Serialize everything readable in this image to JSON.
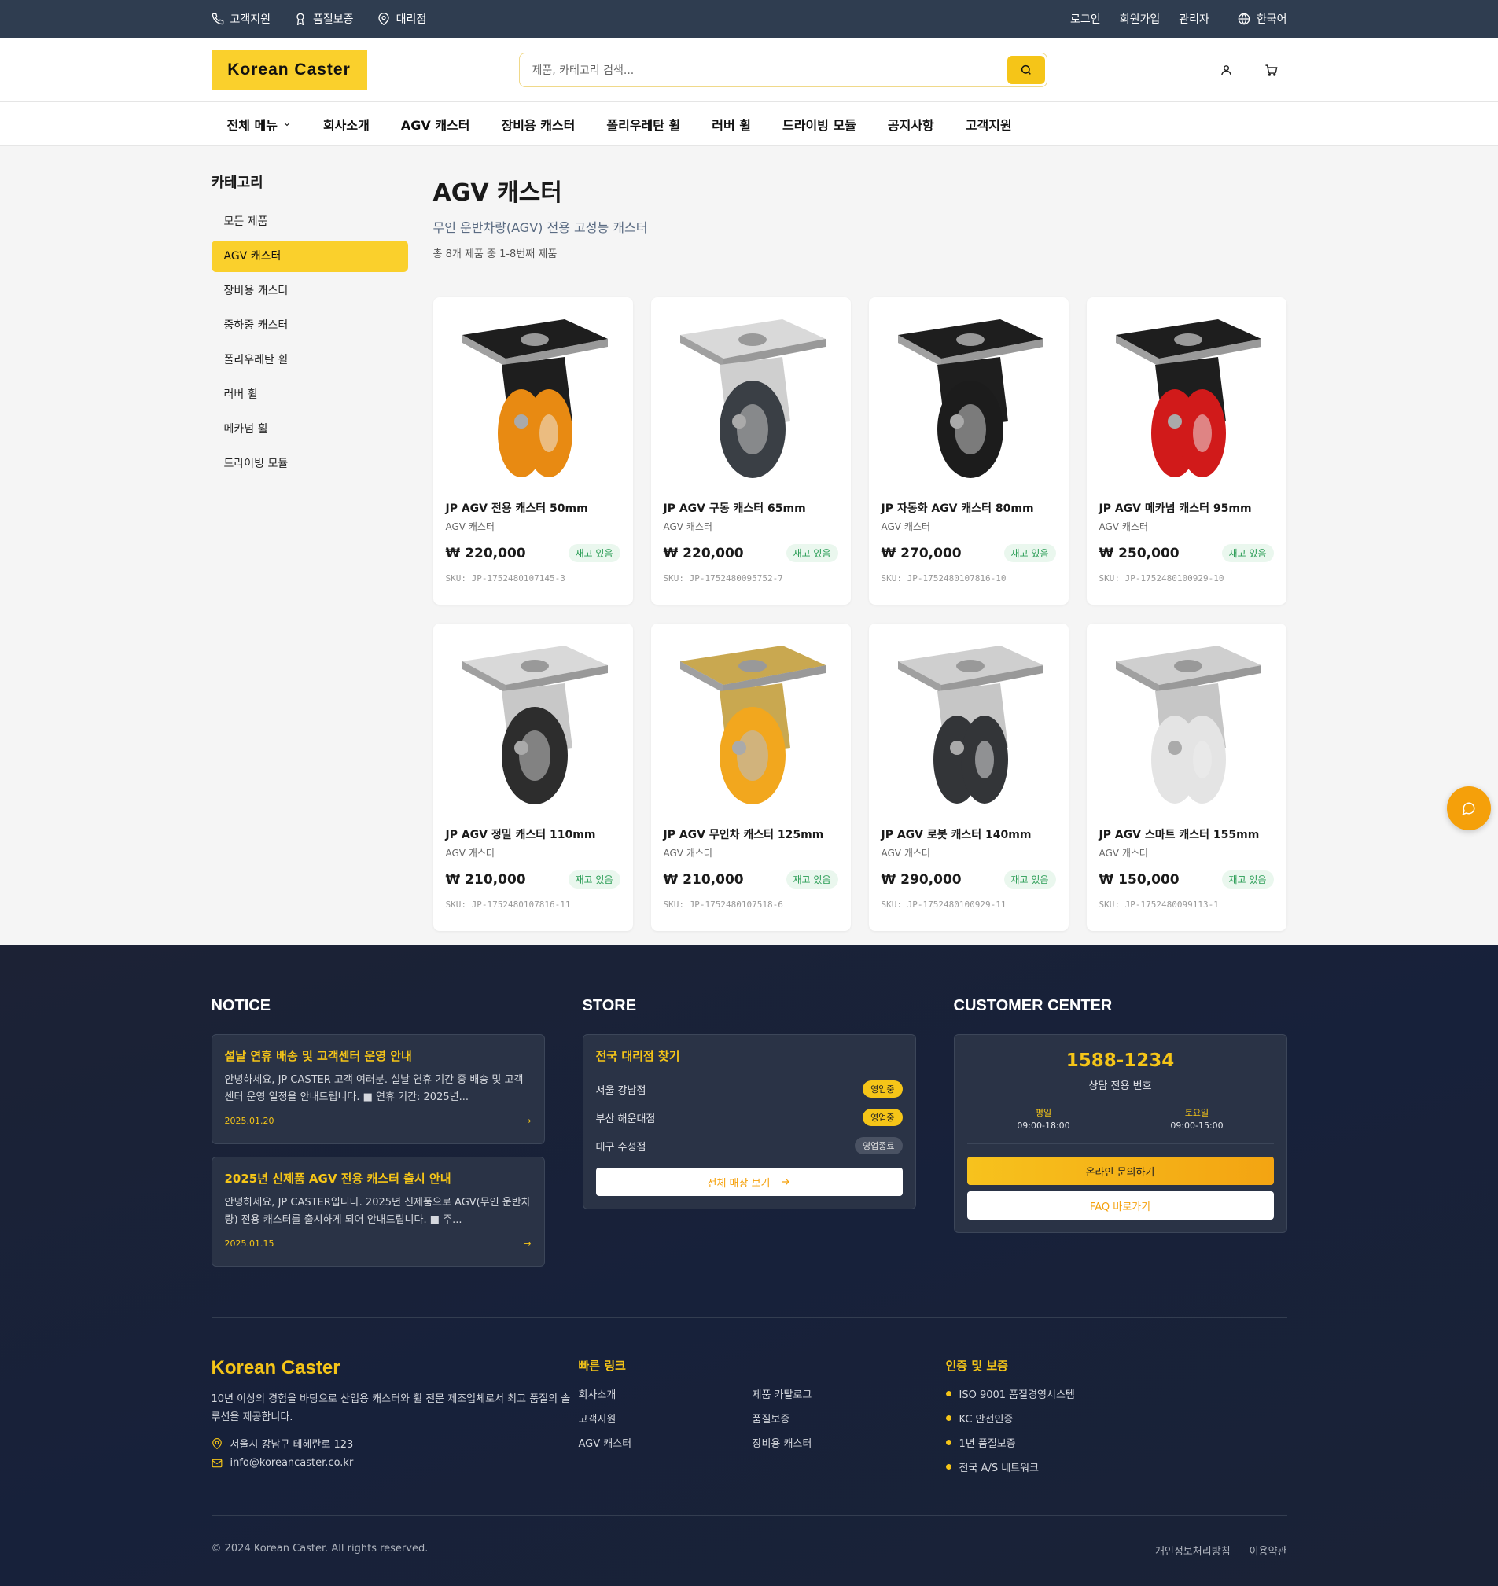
{
  "topbar": {
    "left": [
      {
        "label": "고객지원",
        "icon": "phone-icon"
      },
      {
        "label": "품질보증",
        "icon": "award-icon"
      },
      {
        "label": "대리점",
        "icon": "map-pin-icon"
      }
    ],
    "right": [
      "로그인",
      "회원가입",
      "관리자"
    ],
    "language": "한국어"
  },
  "header": {
    "logo": "Korean Caster",
    "search_placeholder": "제품, 카테고리 검색..."
  },
  "nav": {
    "all_menu": "전체 메뉴",
    "items": [
      "회사소개",
      "AGV 캐스터",
      "장비용 캐스터",
      "폴리우레탄 휠",
      "러버 휠",
      "드라이빙 모듈",
      "공지사항",
      "고객지원"
    ]
  },
  "sidebar": {
    "title": "카테고리",
    "items": [
      "모든 제품",
      "AGV 캐스터",
      "장비용 캐스터",
      "중하중 캐스터",
      "폴리우레탄 휠",
      "러버 휠",
      "메카넘 휠",
      "드라이빙 모듈"
    ],
    "active_index": 1
  },
  "content": {
    "title": "AGV 캐스터",
    "subtitle": "무인 운반차량(AGV) 전용 고성능 캐스터",
    "count": "총 8개 제품 중 1-8번째 제품"
  },
  "products": [
    {
      "name": "JP AGV 전용 캐스터 50mm",
      "category": "AGV 캐스터",
      "price": "₩ 220,000",
      "stock": "재고 있음",
      "sku": "SKU: JP-1752480107145-3",
      "plate": "#1e1e1e",
      "body": "#1e1e1e",
      "wheel": "#e88a12",
      "twin": true
    },
    {
      "name": "JP AGV 구동 캐스터 65mm",
      "category": "AGV 캐스터",
      "price": "₩ 220,000",
      "stock": "재고 있음",
      "sku": "SKU: JP-1752480095752-7",
      "plate": "#d9d9d9",
      "body": "#cfcfcf",
      "wheel": "#3a3f45",
      "twin": false
    },
    {
      "name": "JP 자동화 AGV 캐스터 80mm",
      "category": "AGV 캐스터",
      "price": "₩ 270,000",
      "stock": "재고 있음",
      "sku": "SKU: JP-1752480107816-10",
      "plate": "#1e1e1e",
      "body": "#1e1e1e",
      "wheel": "#1c1c1c",
      "twin": false
    },
    {
      "name": "JP AGV 메카넘 캐스터 95mm",
      "category": "AGV 캐스터",
      "price": "₩ 250,000",
      "stock": "재고 있음",
      "sku": "SKU: JP-1752480100929-10",
      "plate": "#1e1e1e",
      "body": "#1e1e1e",
      "wheel": "#d11a1a",
      "twin": true
    },
    {
      "name": "JP AGV 정밀 캐스터 110mm",
      "category": "AGV 캐스터",
      "price": "₩ 210,000",
      "stock": "재고 있음",
      "sku": "SKU: JP-1752480107816-11",
      "plate": "#d9d9d9",
      "body": "#c8c8c8",
      "wheel": "#2d2d2d",
      "twin": false
    },
    {
      "name": "JP AGV 무인차 캐스터 125mm",
      "category": "AGV 캐스터",
      "price": "₩ 210,000",
      "stock": "재고 있음",
      "sku": "SKU: JP-1752480107518-6",
      "plate": "#c9a850",
      "body": "#c9a850",
      "wheel": "#f2a71e",
      "twin": false
    },
    {
      "name": "JP AGV 로봇 캐스터 140mm",
      "category": "AGV 캐스터",
      "price": "₩ 290,000",
      "stock": "재고 있음",
      "sku": "SKU: JP-1752480100929-11",
      "plate": "#cfcfcf",
      "body": "#c6c6c6",
      "wheel": "#333538",
      "twin": true
    },
    {
      "name": "JP AGV 스마트 캐스터 155mm",
      "category": "AGV 캐스터",
      "price": "₩ 150,000",
      "stock": "재고 있음",
      "sku": "SKU: JP-1752480099113-1",
      "plate": "#cfcfcf",
      "body": "#c6c6c6",
      "wheel": "#e4e4e4",
      "twin": true
    }
  ],
  "footer": {
    "notice": {
      "heading": "NOTICE",
      "items": [
        {
          "title": "설날 연휴 배송 및 고객센터 운영 안내",
          "body": "안녕하세요, JP CASTER 고객 여러분. 설날 연휴 기간 중 배송 및 고객센터 운영 일정을 안내드립니다. ■ 연휴 기간: 2025년...",
          "date": "2025.01.20"
        },
        {
          "title": "2025년 신제품 AGV 전용 캐스터 출시 안내",
          "body": "안녕하세요, JP CASTER입니다. 2025년 신제품으로 AGV(무인 운반차량) 전용 캐스터를 출시하게 되어 안내드립니다. ■ 주...",
          "date": "2025.01.15"
        }
      ]
    },
    "store": {
      "heading": "STORE",
      "title": "전국 대리점 찾기",
      "rows": [
        {
          "name": "서울 강남점",
          "status": "영업중",
          "open": true
        },
        {
          "name": "부산 해운대점",
          "status": "영업중",
          "open": true
        },
        {
          "name": "대구 수성점",
          "status": "영업종료",
          "open": false
        }
      ],
      "button": "전체 매장 보기"
    },
    "cs": {
      "heading": "CUSTOMER CENTER",
      "phone": "1588-1234",
      "phone_label": "상담 전용 번호",
      "weekday_label": "평일",
      "weekday_hours": "09:00-18:00",
      "saturday_label": "토요일",
      "saturday_hours": "09:00-15:00",
      "inquiry_button": "온라인 문의하기",
      "faq_button": "FAQ 바로가기"
    },
    "brand": {
      "logo": "Korean Caster",
      "desc": "10년 이상의 경험을 바탕으로 산업용 캐스터와 휠 전문 제조업체로서 최고 품질의 솔루션을 제공합니다.",
      "address": "서울시 강남구 테헤란로 123",
      "email": "info@koreancaster.co.kr"
    },
    "quick": {
      "title": "빠른 링크",
      "links": [
        "회사소개",
        "제품 카탈로그",
        "고객지원",
        "품질보증",
        "AGV 캐스터",
        "장비용 캐스터"
      ]
    },
    "cert": {
      "title": "인증 및 보증",
      "items": [
        "ISO 9001 품질경영시스템",
        "KC 안전인증",
        "1년 품질보증",
        "전국 A/S 네트워크"
      ]
    },
    "copyright": "© 2024 Korean Caster. All rights reserved.",
    "legal": [
      "개인정보처리방침",
      "이용약관"
    ]
  },
  "colors": {
    "accent": "#fad02c",
    "topbar": "#2f3d50",
    "footer": "#1c2235",
    "stock_green": "#2a9d55"
  }
}
